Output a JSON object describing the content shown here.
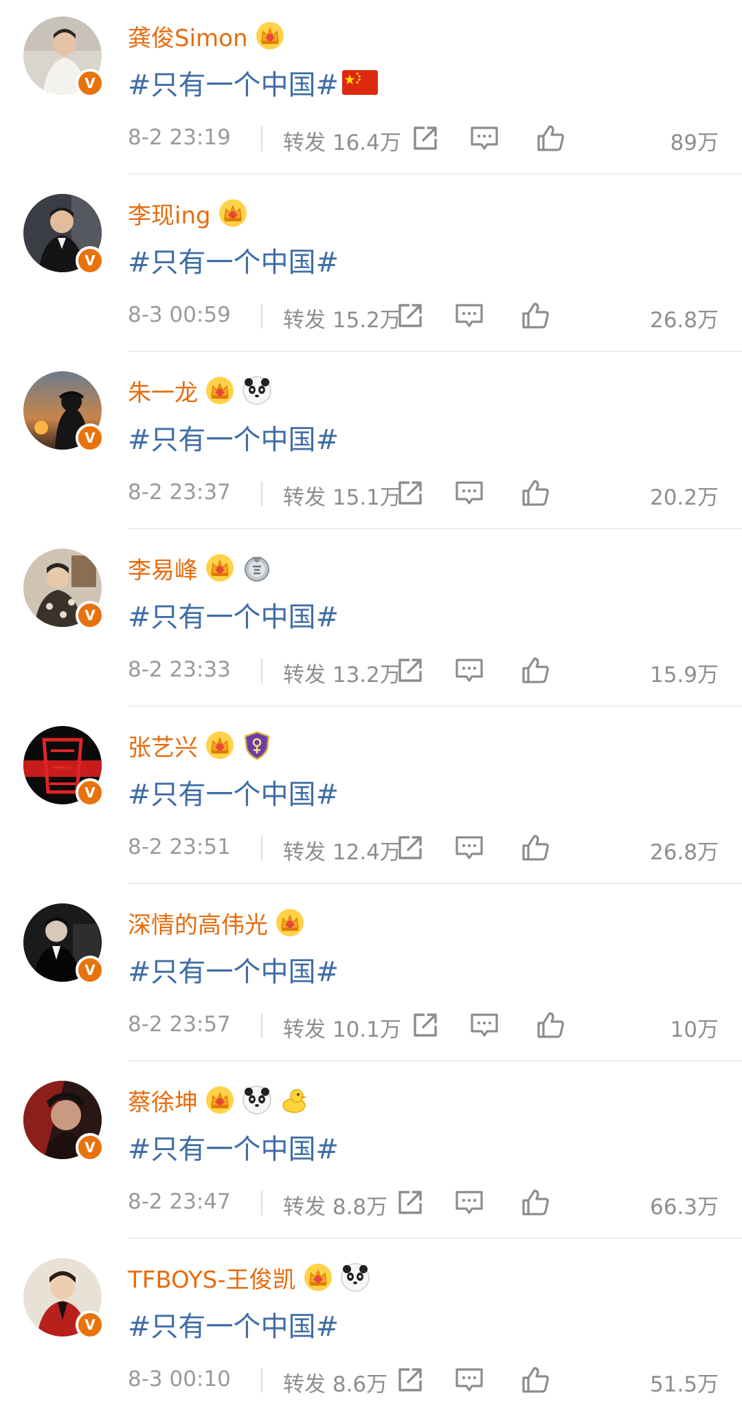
{
  "posts": [
    {
      "name": "龚俊Simon",
      "badges": [
        "crown-badge"
      ],
      "topic": "#只有一个中国#",
      "flag": true,
      "time": "8-2 23:19",
      "repost_label": "转发",
      "repost_count": "16.4万",
      "likes": "89万"
    },
    {
      "name": "李现ing",
      "badges": [
        "crown-badge"
      ],
      "topic": "#只有一个中国#",
      "flag": false,
      "time": "8-3 00:59",
      "repost_label": "转发",
      "repost_count": "15.2万",
      "likes": "26.8万"
    },
    {
      "name": "朱一龙",
      "badges": [
        "crown-badge",
        "panda-badge"
      ],
      "topic": "#只有一个中国#",
      "flag": false,
      "time": "8-2 23:37",
      "repost_label": "转发",
      "repost_count": "15.1万",
      "likes": "20.2万"
    },
    {
      "name": "李易峰",
      "badges": [
        "crown-badge",
        "answer-medal-badge"
      ],
      "topic": "#只有一个中国#",
      "flag": false,
      "time": "8-2 23:33",
      "repost_label": "转发",
      "repost_count": "13.2万",
      "likes": "15.9万"
    },
    {
      "name": "张艺兴",
      "badges": [
        "crown-badge",
        "shield-badge"
      ],
      "topic": "#只有一个中国#",
      "flag": false,
      "time": "8-2 23:51",
      "repost_label": "转发",
      "repost_count": "12.4万",
      "likes": "26.8万"
    },
    {
      "name": "深情的高伟光",
      "badges": [
        "crown-badge"
      ],
      "topic": "#只有一个中国#",
      "flag": false,
      "time": "8-2 23:57",
      "repost_label": "转发",
      "repost_count": "10.1万",
      "likes": "10万"
    },
    {
      "name": "蔡徐坤",
      "badges": [
        "crown-badge",
        "panda-badge",
        "duck-badge"
      ],
      "topic": "#只有一个中国#",
      "flag": false,
      "time": "8-2 23:47",
      "repost_label": "转发",
      "repost_count": "8.8万",
      "likes": "66.3万"
    },
    {
      "name": "TFBOYS-王俊凯",
      "badges": [
        "crown-badge",
        "panda-badge"
      ],
      "topic": "#只有一个中国#",
      "flag": false,
      "time": "8-3 00:10",
      "repost_label": "转发",
      "repost_count": "8.6万",
      "likes": "51.5万"
    }
  ],
  "verified_badge_letter": "V",
  "colors": {
    "name": "#e86b0c",
    "topic": "#3f6da6",
    "meta": "#9a9a9a",
    "verified": "#e8720c"
  }
}
